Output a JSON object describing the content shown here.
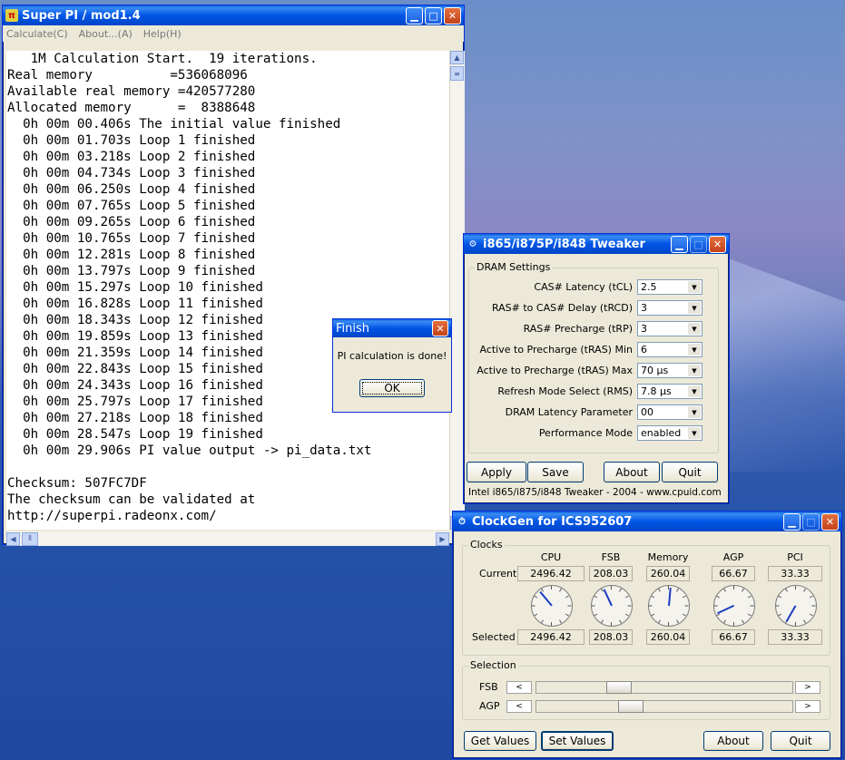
{
  "superpi": {
    "title": "Super PI / mod1.4",
    "menu": [
      "Calculate(C)",
      "About...(A)",
      "Help(H)"
    ],
    "console_lines": [
      "   1M Calculation Start.  19 iterations.",
      "Real memory          =536068096",
      "Available real memory =420577280",
      "Allocated memory      =  8388648",
      "  0h 00m 00.406s The initial value finished",
      "  0h 00m 01.703s Loop 1 finished",
      "  0h 00m 03.218s Loop 2 finished",
      "  0h 00m 04.734s Loop 3 finished",
      "  0h 00m 06.250s Loop 4 finished",
      "  0h 00m 07.765s Loop 5 finished",
      "  0h 00m 09.265s Loop 6 finished",
      "  0h 00m 10.765s Loop 7 finished",
      "  0h 00m 12.281s Loop 8 finished",
      "  0h 00m 13.797s Loop 9 finished",
      "  0h 00m 15.297s Loop 10 finished",
      "  0h 00m 16.828s Loop 11 finished",
      "  0h 00m 18.343s Loop 12 finished",
      "  0h 00m 19.859s Loop 13 finished",
      "  0h 00m 21.359s Loop 14 finished",
      "  0h 00m 22.843s Loop 15 finished",
      "  0h 00m 24.343s Loop 16 finished",
      "  0h 00m 25.797s Loop 17 finished",
      "  0h 00m 27.218s Loop 18 finished",
      "  0h 00m 28.547s Loop 19 finished",
      "  0h 00m 29.906s PI value output -> pi_data.txt",
      "",
      "Checksum: 507FC7DF",
      "The checksum can be validated at",
      "http://superpi.radeonx.com/"
    ]
  },
  "finish_dialog": {
    "title": "Finish",
    "message": "PI calculation is done!",
    "ok_label": "OK"
  },
  "tweaker": {
    "title": "i865/i875P/i848 Tweaker",
    "group_label": "DRAM Settings",
    "settings": [
      {
        "label": "CAS# Latency (tCL)",
        "value": "2.5"
      },
      {
        "label": "RAS# to CAS# Delay (tRCD)",
        "value": "3"
      },
      {
        "label": "RAS# Precharge (tRP)",
        "value": "3"
      },
      {
        "label": "Active to Precharge (tRAS) Min",
        "value": "6"
      },
      {
        "label": "Active to Precharge (tRAS) Max",
        "value": "70 µs"
      },
      {
        "label": "Refresh Mode Select (RMS)",
        "value": "7.8 µs"
      },
      {
        "label": "DRAM Latency Parameter",
        "value": "00"
      },
      {
        "label": "Performance Mode",
        "value": "enabled"
      }
    ],
    "buttons": [
      "Apply",
      "Save",
      "About",
      "Quit"
    ],
    "footer": "Intel i865/i875/i848 Tweaker - 2004 - www.cpuid.com"
  },
  "clockgen": {
    "title": "ClockGen for ICS952607",
    "clocks_label": "Clocks",
    "columns": [
      "CPU",
      "FSB",
      "Memory",
      "AGP",
      "PCI"
    ],
    "current_label": "Current",
    "selected_label": "Selected",
    "current": [
      "2496.42",
      "208.03",
      "260.04",
      "66.67",
      "33.33"
    ],
    "selected": [
      "2496.42",
      "208.03",
      "260.04",
      "66.67",
      "33.33"
    ],
    "selection_label": "Selection",
    "sliders": [
      {
        "label": "FSB",
        "level": 0.3
      },
      {
        "label": "AGP",
        "level": 0.35
      }
    ],
    "buttons": [
      "Get Values",
      "Set Values",
      "About",
      "Quit"
    ]
  }
}
